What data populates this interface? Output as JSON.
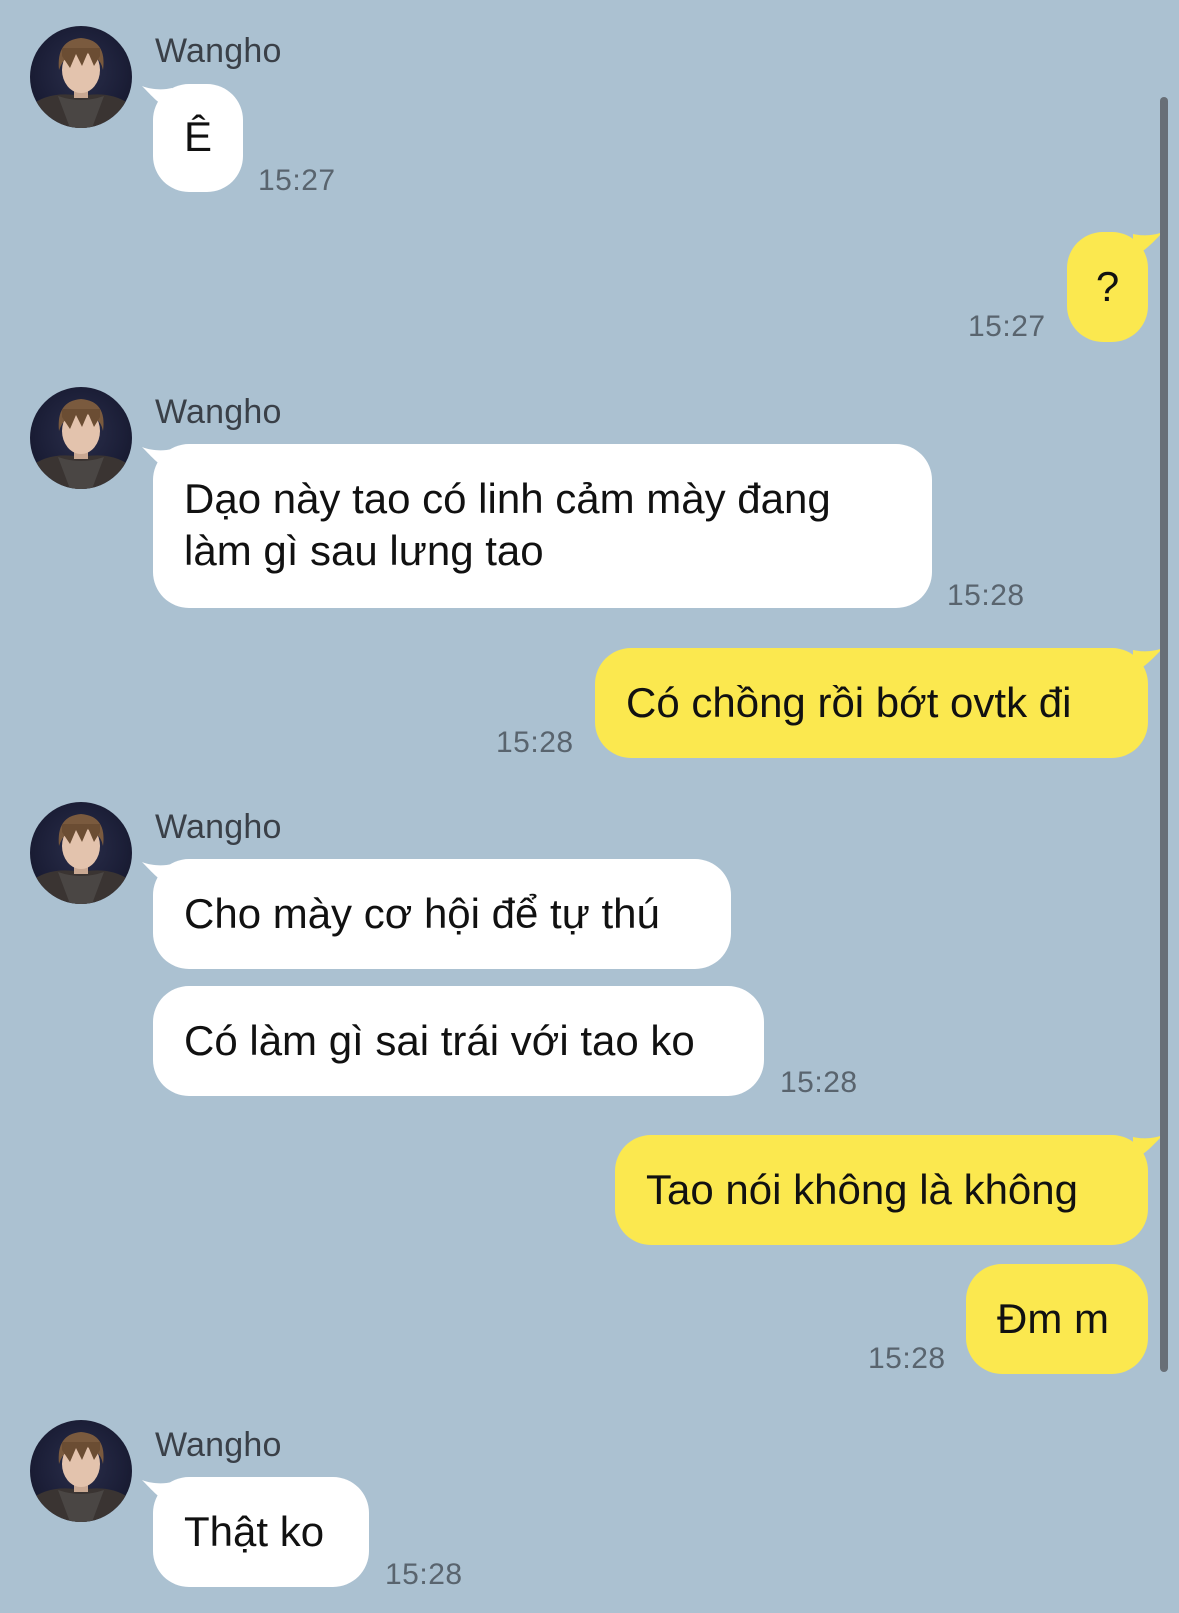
{
  "chat": {
    "colors": {
      "background": "#abc1d1",
      "incoming_bubble": "#ffffff",
      "outgoing_bubble": "#fbe84f",
      "timestamp": "#59646e"
    },
    "messages": [
      {
        "direction": "incoming",
        "sender": "Wangho",
        "text": "Ê",
        "time": "15:27"
      },
      {
        "direction": "outgoing",
        "text": "?",
        "time": "15:27"
      },
      {
        "direction": "incoming",
        "sender": "Wangho",
        "text": "Dạo này tao có linh cảm mày đang làm gì sau lưng tao",
        "time": "15:28"
      },
      {
        "direction": "outgoing",
        "text": "Có chồng rồi bớt ovtk đi",
        "time": "15:28"
      },
      {
        "direction": "incoming",
        "sender": "Wangho",
        "text": "Cho mày cơ hội để tự thú"
      },
      {
        "direction": "incoming",
        "text": "Có làm gì sai trái với tao ko",
        "time": "15:28"
      },
      {
        "direction": "outgoing",
        "text": "Tao nói không là không"
      },
      {
        "direction": "outgoing",
        "text": "Đm m",
        "time": "15:28"
      },
      {
        "direction": "incoming",
        "sender": "Wangho",
        "text": "Thật ko",
        "time": "15:28"
      }
    ]
  }
}
